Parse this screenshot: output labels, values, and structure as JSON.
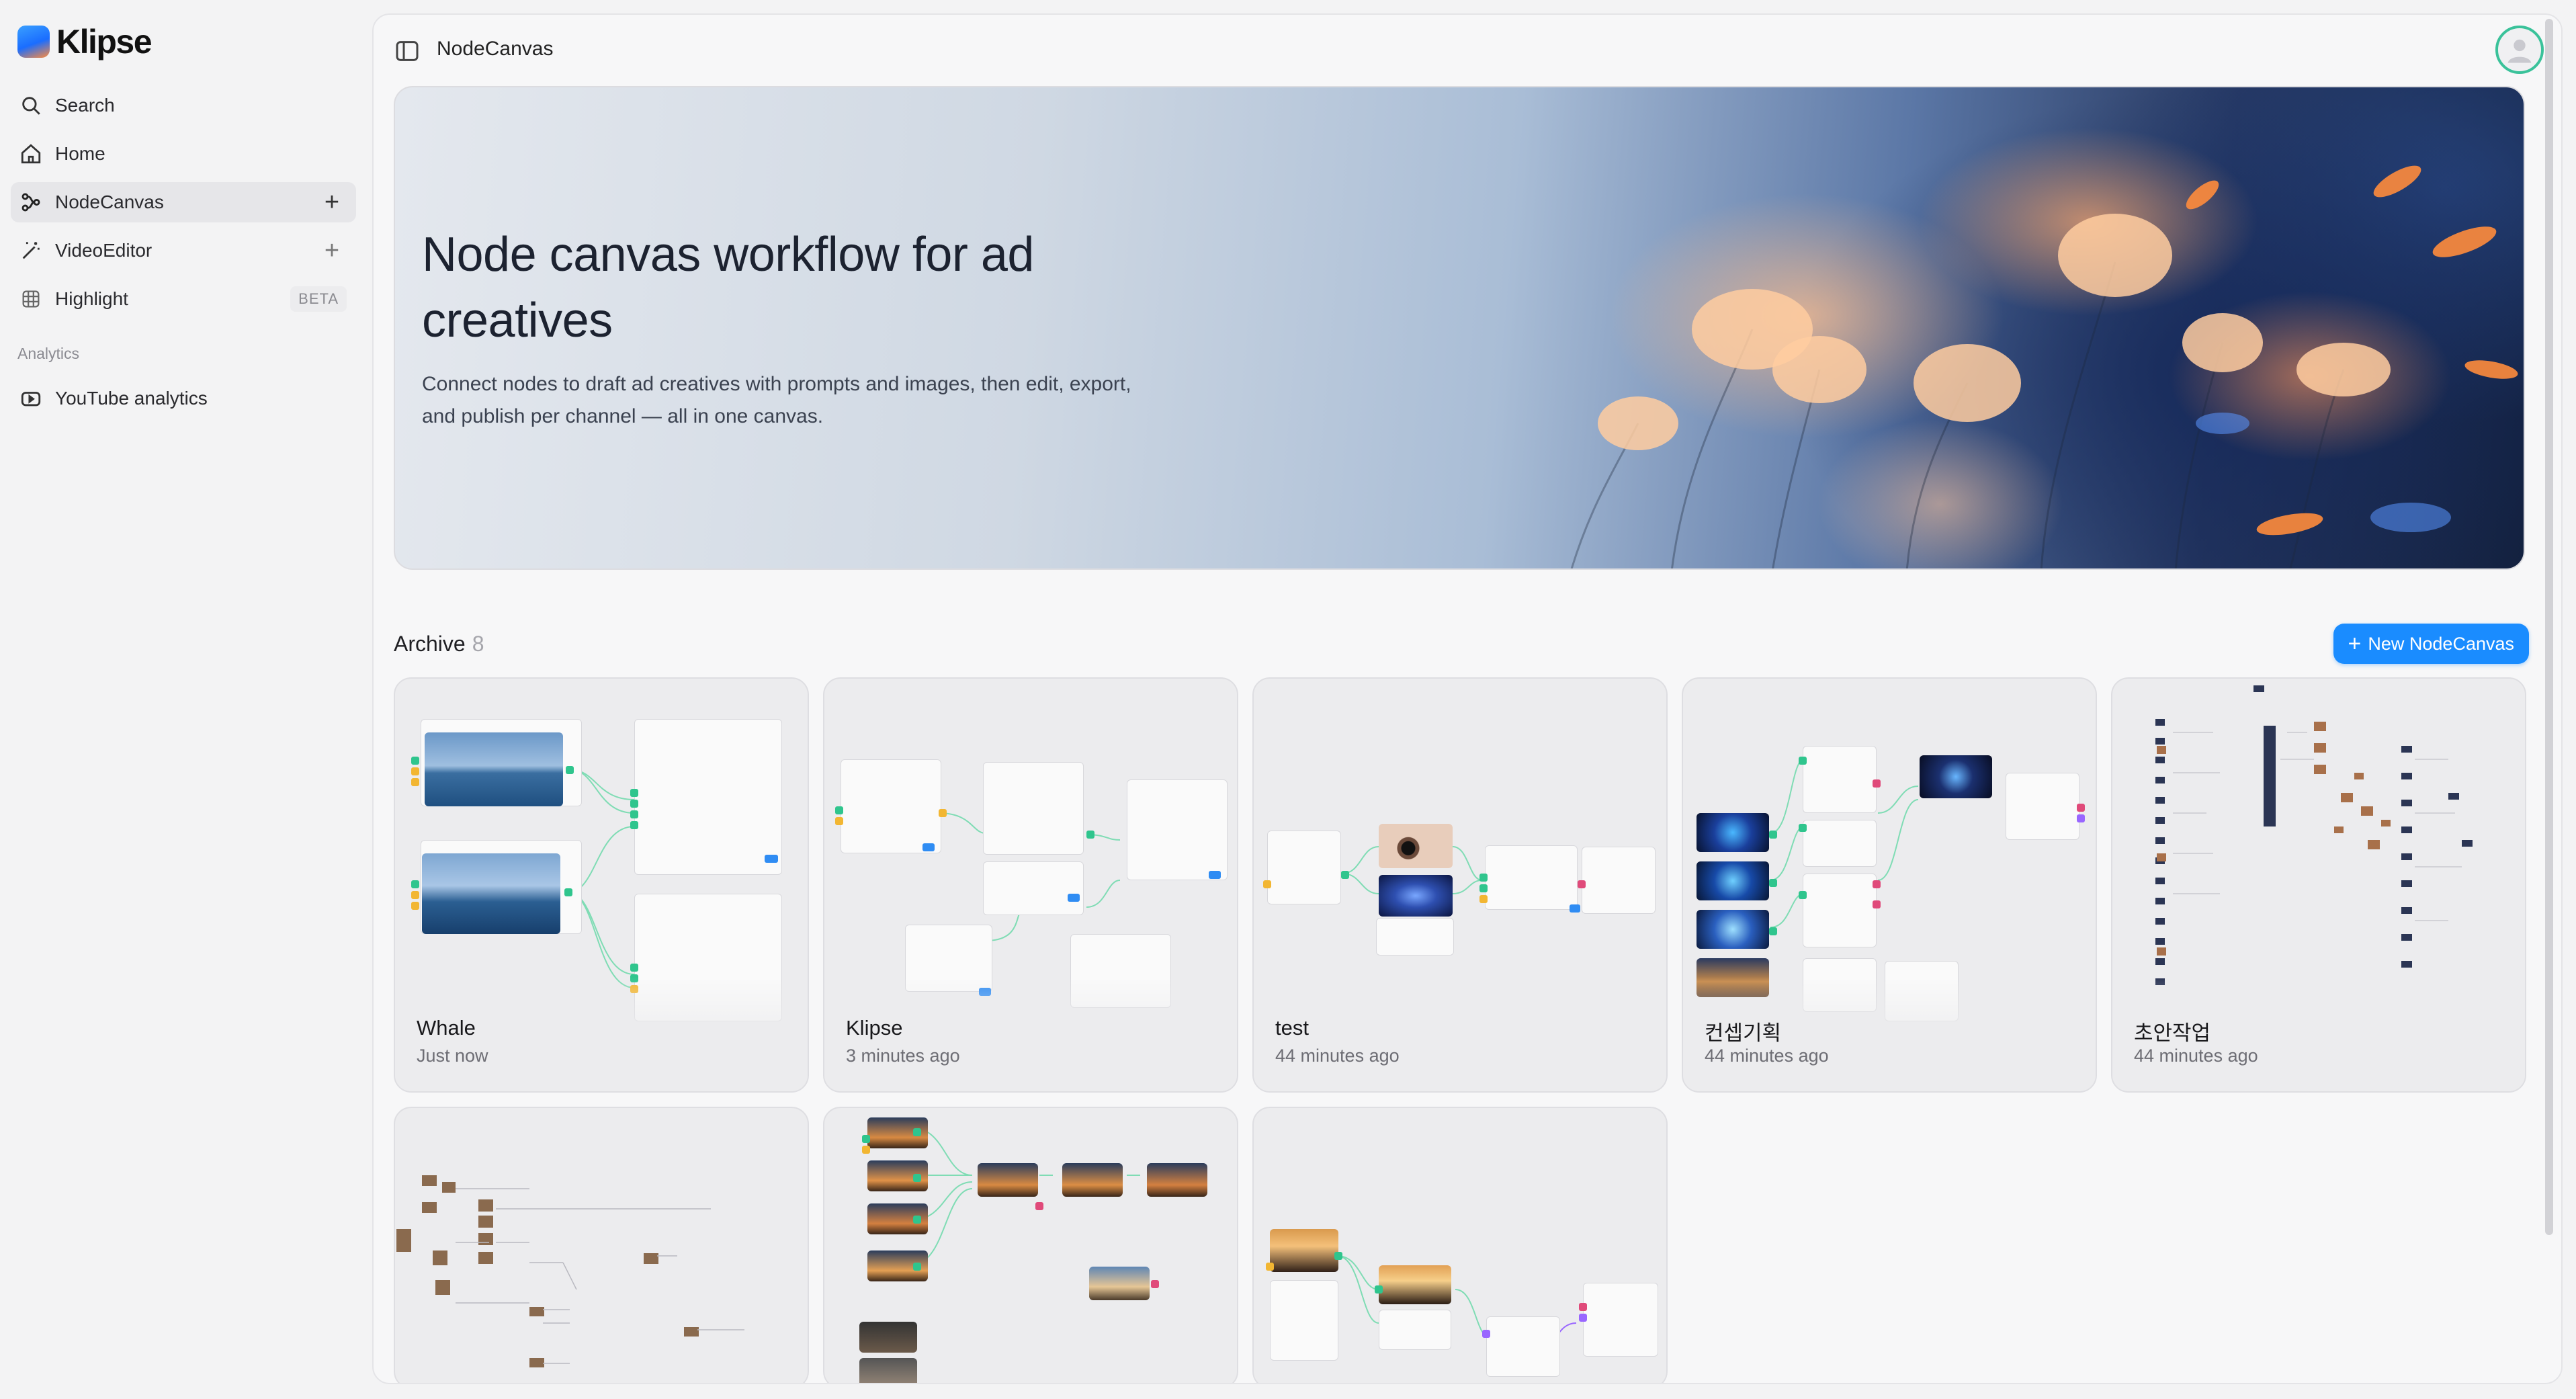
{
  "brand": {
    "name": "Klipse"
  },
  "sidebar": {
    "items": [
      {
        "label": "Search",
        "icon": "search-icon"
      },
      {
        "label": "Home",
        "icon": "home-icon"
      },
      {
        "label": "NodeCanvas",
        "icon": "node-graph-icon",
        "active": true
      },
      {
        "label": "VideoEditor",
        "icon": "magic-wand-icon"
      },
      {
        "label": "Highlight",
        "icon": "grid-icon",
        "badge": "BETA"
      }
    ],
    "section": "Analytics",
    "analytics": [
      {
        "label": "YouTube analytics",
        "icon": "youtube-icon"
      }
    ]
  },
  "topbar": {
    "title": "NodeCanvas"
  },
  "hero": {
    "title": "Node canvas workflow for ad creatives",
    "description": "Connect nodes to draft ad creatives with prompts and images, then edit, export, and publish per channel — all in one canvas."
  },
  "archive": {
    "label": "Archive",
    "count": "8",
    "new_button": "New NodeCanvas",
    "cards": [
      {
        "title": "Whale",
        "time": "Just now"
      },
      {
        "title": "Klipse",
        "time": "3 minutes ago"
      },
      {
        "title": "test",
        "time": "44 minutes ago"
      },
      {
        "title": "컨셉기획",
        "time": "44 minutes ago"
      },
      {
        "title": "초안작업",
        "time": "44 minutes ago"
      },
      {
        "title": "",
        "time": ""
      },
      {
        "title": "",
        "time": ""
      },
      {
        "title": "",
        "time": ""
      }
    ]
  },
  "colors": {
    "accent": "#1a8cff",
    "avatar_ring": "#3ac29a",
    "port_green": "#2fc58d",
    "port_yellow": "#f2b632"
  }
}
